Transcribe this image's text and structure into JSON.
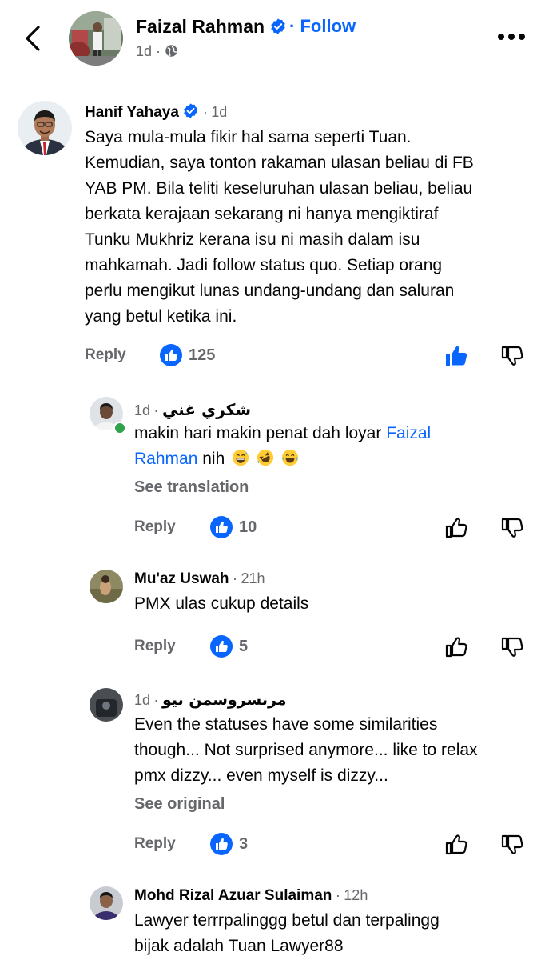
{
  "header": {
    "author": "Faizal Rahman",
    "follow_label": "Follow",
    "time": "1d",
    "separator": "·"
  },
  "comments": [
    {
      "name": "Hanif Yahaya",
      "time": "1d",
      "verified": true,
      "lines": [
        "Saya mula-mula fikir hal sama seperti Tuan.",
        "Kemudian, saya tonton rakaman ulasan beliau di FB",
        "YAB PM. Bila teliti keseluruhan ulasan beliau, beliau",
        "berkata kerajaan sekarang ni hanya mengiktiraf",
        "Tunku Mukhriz kerana isu ni masih dalam isu",
        "mahkamah. Jadi follow status quo. Setiap orang",
        "perlu mengikut lunas undang-undang dan saluran",
        "yang betul ketika ini."
      ],
      "reply_label": "Reply",
      "likes": "125",
      "liked_by_viewer": true
    },
    {
      "name": "شكري غني",
      "time": "1d",
      "online": true,
      "text_before_link": "makin hari makin penat dah loyar",
      "link_line1": "Faizal",
      "link_line2": "Rahman",
      "text_after_link": "nih",
      "emojis": [
        "grinning-sweat-emoji",
        "rofl-emoji",
        "tears-of-joy-emoji"
      ],
      "action": "See translation",
      "reply_label": "Reply",
      "likes": "10"
    },
    {
      "name": "Mu'az Uswah",
      "time": "21h",
      "lines": [
        "PMX ulas cukup details"
      ],
      "reply_label": "Reply",
      "likes": "5"
    },
    {
      "name": "مرنسروسمن نيو",
      "time": "1d",
      "lines": [
        "Even the statuses have some similarities",
        "though... Not surprised anymore... like to relax",
        "pmx dizzy... even myself is dizzy..."
      ],
      "action": "See original",
      "reply_label": "Reply",
      "likes": "3"
    },
    {
      "name": "Mohd Rizal Azuar Sulaiman",
      "time": "12h",
      "lines": [
        "Lawyer terrrpalinggg betul dan terpalingg",
        "bijak adalah Tuan Lawyer88"
      ]
    }
  ],
  "colors": {
    "accent_blue": "#0866ff",
    "secondary_text": "#65676b",
    "online_green": "#31a24c"
  }
}
